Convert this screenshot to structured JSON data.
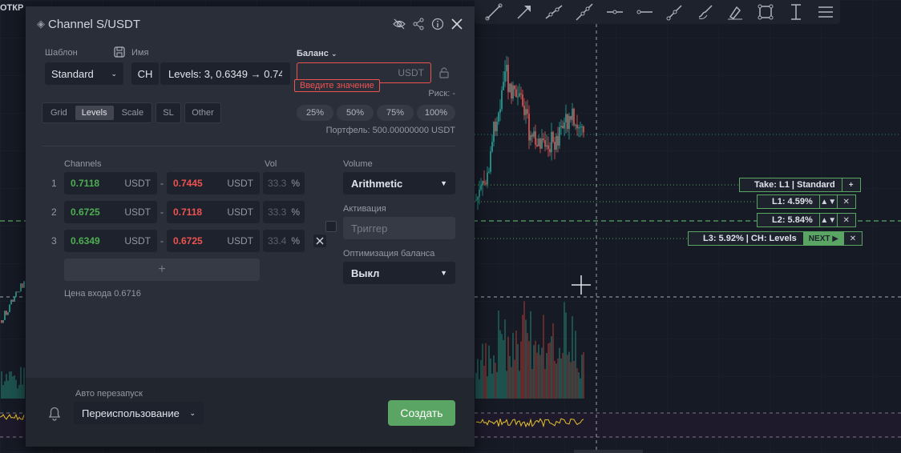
{
  "ticker_fragment": "ОТКР",
  "modal": {
    "title": "Channel S/USDT",
    "template_label": "Шаблон",
    "template_value": "Standard",
    "name_label": "Имя",
    "name_prefix": "CH",
    "name_value": "Levels: 3, 0.6349 → 0.74",
    "balance_label": "Баланс",
    "balance_currency": "USDT",
    "balance_placeholder": "",
    "balance_error": "Введите значение",
    "risk_label": "Риск: -",
    "percents": [
      "25%",
      "50%",
      "75%",
      "100%"
    ],
    "portfolio": "Портфель: 500.00000000  USDT",
    "tabs": [
      "Grid",
      "Levels",
      "Scale"
    ],
    "tab_sl": "SL",
    "tab_other": "Other",
    "channels_label": "Channels",
    "vol_label": "Vol",
    "channels": [
      {
        "n": "1",
        "low": "0.7118",
        "high": "0.7445",
        "unit": "USDT",
        "vol": "33.3",
        "pct": "%"
      },
      {
        "n": "2",
        "low": "0.6725",
        "high": "0.7118",
        "unit": "USDT",
        "vol": "33.3",
        "pct": "%"
      },
      {
        "n": "3",
        "low": "0.6349",
        "high": "0.6725",
        "unit": "USDT",
        "vol": "33.4",
        "pct": "%"
      }
    ],
    "add_label": "+",
    "entry_price": "Цена входа 0.6716",
    "volume_label": "Volume",
    "volume_value": "Arithmetic",
    "activation_label": "Активация",
    "activation_placeholder": "Триггер",
    "balance_opt_label": "Оптимизация баланса",
    "balance_opt_value": "Выкл",
    "auto_restart_label": "Авто перезапуск",
    "auto_restart_value": "Переиспользование",
    "create_label": "Создать"
  },
  "levels": {
    "take": "Take: L1 | Standard",
    "take_plus": "+",
    "l1": "L1: 4.59%",
    "l2": "L2: 5.84%",
    "l3": "L3: 5.92% | CH: Levels",
    "next": "NEXT ▶",
    "arrows": "▲▼",
    "close": "✕"
  },
  "colors": {
    "accent_green": "#5aa564",
    "error_red": "#ef5350"
  }
}
